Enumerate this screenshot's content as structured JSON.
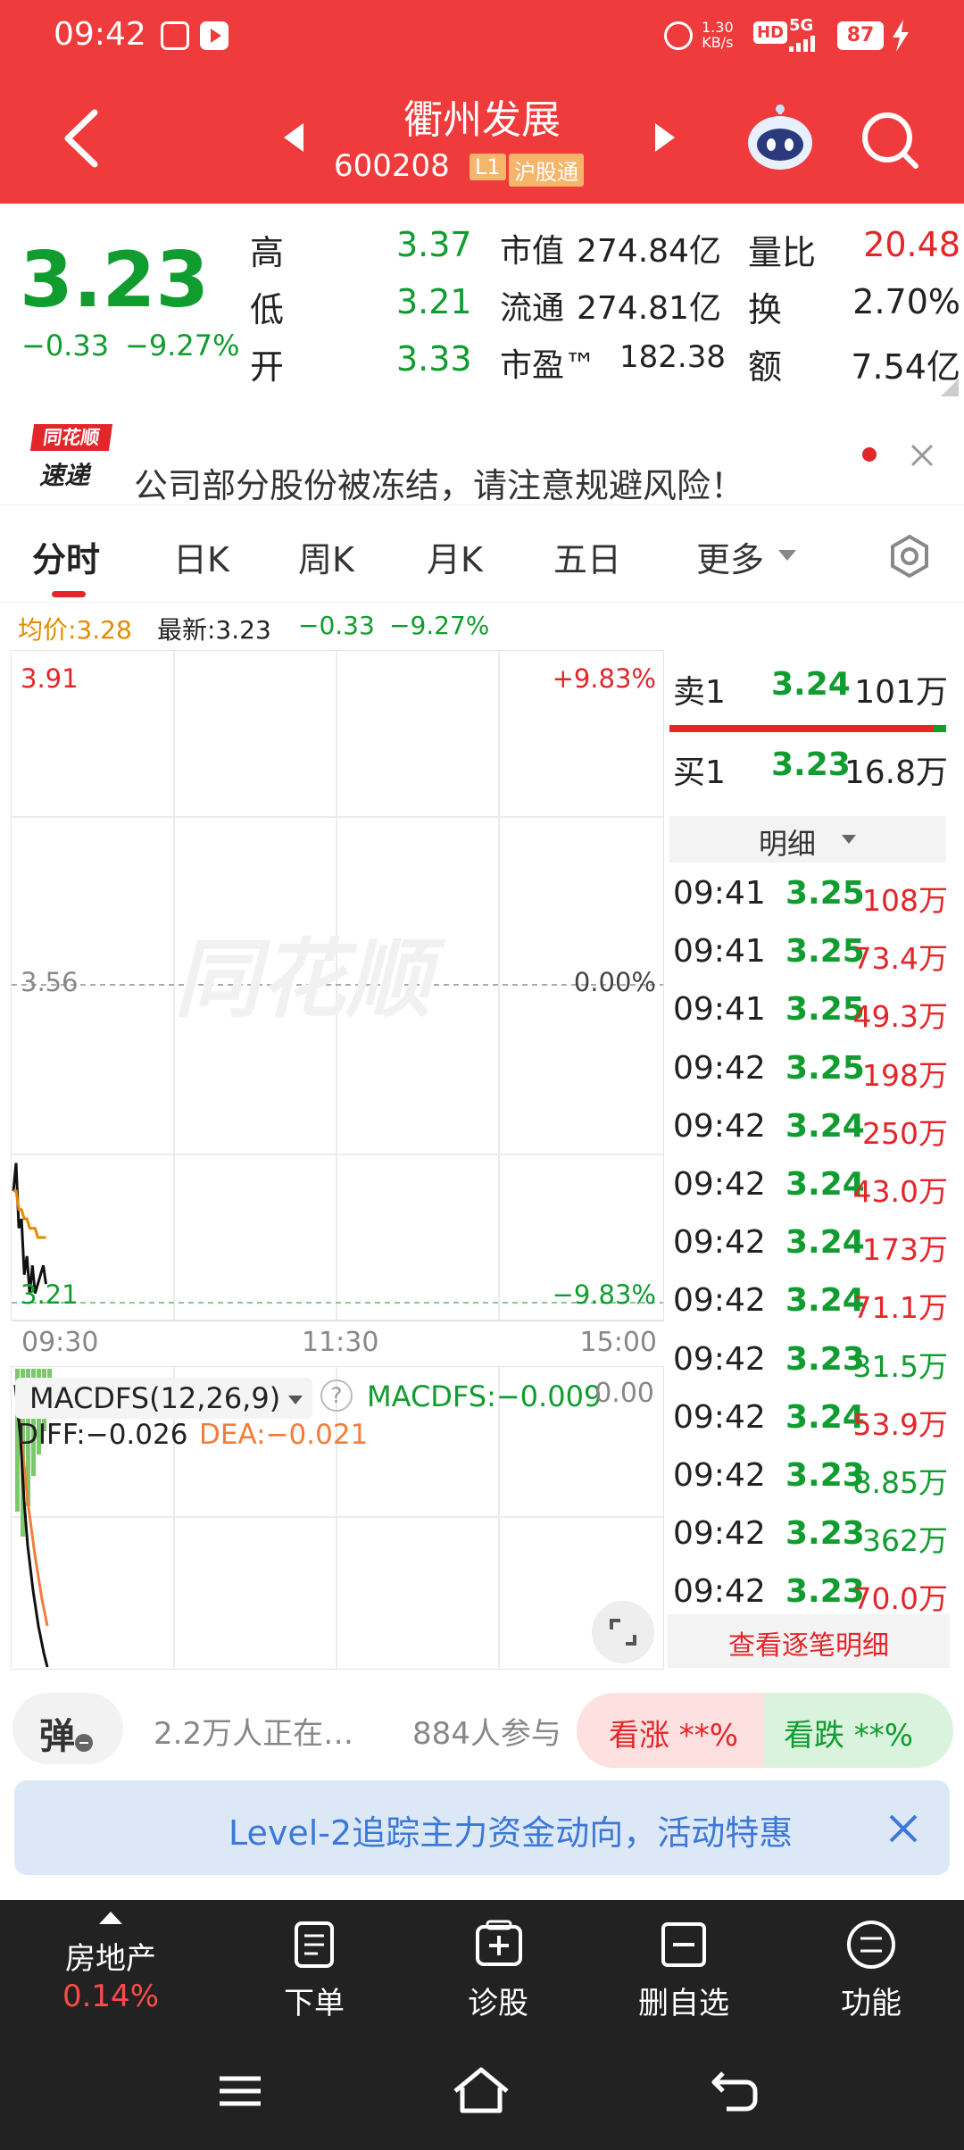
{
  "status_bar": {
    "time": "09:42",
    "net_speed_value": "1.30",
    "net_speed_unit": "KB/s",
    "hd": "HD",
    "network": "5G",
    "battery": "87"
  },
  "header": {
    "title": "衢州发展",
    "code": "600208",
    "level_badge": "L1",
    "market_badge": "沪股通"
  },
  "quote": {
    "price": "3.23",
    "change": "−0.33",
    "change_pct": "−9.27%",
    "rows": [
      {
        "l1": "高",
        "v1": "3.37",
        "l2": "市值",
        "v2": "274.84亿",
        "l3": "量比",
        "v3": "20.48"
      },
      {
        "l1": "低",
        "v1": "3.21",
        "l2": "流通",
        "v2": "274.81亿",
        "l3": "换",
        "v3": "2.70%"
      },
      {
        "l1": "开",
        "v1": "3.33",
        "l2": "市盈™",
        "v2": "182.38",
        "l3": "额",
        "v3": "7.54亿"
      }
    ]
  },
  "notice": {
    "logo_line1": "同花顺",
    "logo_line2": "速递",
    "text": "公司部分股份被冻结，请注意规避风险！"
  },
  "tabs": [
    "分时",
    "日K",
    "周K",
    "月K",
    "五日",
    "更多"
  ],
  "info_line": {
    "avg_price": "均价:3.28",
    "latest": "最新:3.23",
    "change": "−0.33",
    "change_pct": "−9.27%"
  },
  "chart": {
    "y_top": "3.91",
    "y_mid": "3.56",
    "y_bottom": "3.21",
    "pct_top": "+9.83%",
    "pct_mid": "0.00%",
    "pct_bottom": "−9.83%",
    "time_start": "09:30",
    "time_mid": "11:30",
    "time_end": "15:00",
    "watermark": "同花顺"
  },
  "chart_data": {
    "type": "line",
    "x": [
      "09:30",
      "09:31",
      "09:32",
      "09:33",
      "09:34",
      "09:35",
      "09:36",
      "09:37",
      "09:38",
      "09:39",
      "09:40",
      "09:41",
      "09:42"
    ],
    "series": [
      {
        "values": [
          3.33,
          3.36,
          3.29,
          3.3,
          3.24,
          3.26,
          3.22,
          3.25,
          3.22,
          3.23,
          3.24,
          3.25,
          3.23
        ]
      },
      {
        "values": [
          3.33,
          3.33,
          3.31,
          3.31,
          3.3,
          3.3,
          3.29,
          3.29,
          3.29,
          3.28,
          3.28,
          3.28,
          3.28
        ]
      }
    ],
    "ylim": [
      3.21,
      3.91
    ],
    "xlim": [
      "09:30",
      "15:00"
    ]
  },
  "macd": {
    "title": "MACDFS(12,26,9)",
    "help_icon": "?",
    "value_label": "MACDFS:−0.009",
    "zero": "0.00",
    "diff": "DIFF:−0.026",
    "dea": "DEA:−0.021"
  },
  "order_book": {
    "sell1_label": "卖1",
    "sell1_price": "3.24",
    "sell1_vol": "101万",
    "buy1_label": "买1",
    "buy1_price": "3.23",
    "buy1_vol": "16.8万",
    "detail_label": "明细",
    "view_all": "查看逐笔明细",
    "trades": [
      {
        "time": "09:41",
        "price": "3.25",
        "vol": "108万",
        "side": "red"
      },
      {
        "time": "09:41",
        "price": "3.25",
        "vol": "73.4万",
        "side": "red"
      },
      {
        "time": "09:41",
        "price": "3.25",
        "vol": "49.3万",
        "side": "red"
      },
      {
        "time": "09:42",
        "price": "3.25",
        "vol": "198万",
        "side": "red"
      },
      {
        "time": "09:42",
        "price": "3.24",
        "vol": "250万",
        "side": "red"
      },
      {
        "time": "09:42",
        "price": "3.24",
        "vol": "43.0万",
        "side": "red"
      },
      {
        "time": "09:42",
        "price": "3.24",
        "vol": "173万",
        "side": "red"
      },
      {
        "time": "09:42",
        "price": "3.24",
        "vol": "71.1万",
        "side": "red"
      },
      {
        "time": "09:42",
        "price": "3.23",
        "vol": "31.5万",
        "side": "green"
      },
      {
        "time": "09:42",
        "price": "3.24",
        "vol": "53.9万",
        "side": "red"
      },
      {
        "time": "09:42",
        "price": "3.23",
        "vol": "8.85万",
        "side": "green"
      },
      {
        "time": "09:42",
        "price": "3.23",
        "vol": "362万",
        "side": "green"
      },
      {
        "time": "09:42",
        "price": "3.23",
        "vol": "70.0万",
        "side": "red"
      }
    ]
  },
  "social": {
    "danmu_label": "弹",
    "watching": "2.2万人正在…",
    "participants": "884人参与",
    "bull": "看涨 **%",
    "bear": "看跌 **%"
  },
  "banner": {
    "text": "Level-2追踪主力资金动向，活动特惠"
  },
  "bottom_nav": {
    "sector_name": "房地产",
    "sector_change": "0.14%",
    "items": [
      "下单",
      "诊股",
      "删自选",
      "功能"
    ]
  },
  "colors": {
    "brand_red": "#ef3b3b",
    "up_red": "#e3262a",
    "down_green": "#109c2f",
    "avg_orange": "#e38a00"
  }
}
